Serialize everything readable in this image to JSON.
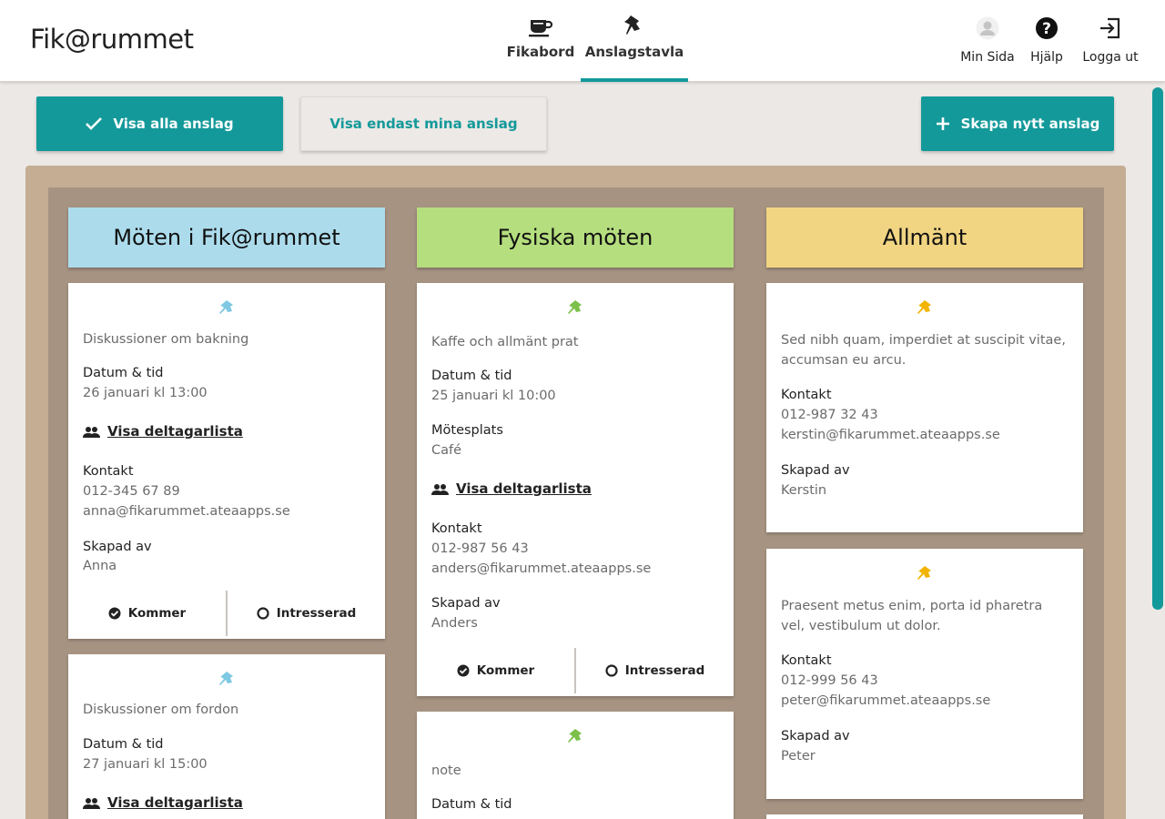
{
  "app": {
    "title": "Fik@rummet"
  },
  "nav": {
    "tabs": [
      {
        "label": "Fikabord",
        "icon": "coffee-cup-icon"
      },
      {
        "label": "Anslagstavla",
        "icon": "pushpin-icon",
        "active": true
      }
    ],
    "utility": [
      {
        "label": "Min Sida",
        "icon": "avatar-icon"
      },
      {
        "label": "Hjälp",
        "icon": "help-icon"
      },
      {
        "label": "Logga ut",
        "icon": "logout-icon"
      }
    ]
  },
  "toolbar": {
    "show_all": "Visa alla anslag",
    "show_mine": "Visa endast mina anslag",
    "create_new": "Skapa nytt anslag"
  },
  "colors": {
    "accent": "#14999a",
    "blue": "#acdcec",
    "green": "#b5de7e",
    "yellow": "#f1d582",
    "board": "#a69382"
  },
  "board": {
    "columns": [
      {
        "title": "Möten i Fik@rummet",
        "cards": [
          {
            "description": "Diskussioner om bakning",
            "datetime_label": "Datum & tid",
            "datetime": "26 januari kl 13:00",
            "participants_link": "Visa deltagarlista",
            "contact_label": "Kontakt",
            "phone": "012-345 67 89",
            "email": "anna@fikarummet.ateaapps.se",
            "created_label": "Skapad av",
            "created_by": "Anna",
            "attend": "Kommer",
            "interested": "Intresserad"
          },
          {
            "description": "Diskussioner om fordon",
            "datetime_label": "Datum & tid",
            "datetime": "27 januari kl 15:00",
            "participants_link": "Visa deltagarlista"
          }
        ]
      },
      {
        "title": "Fysiska möten",
        "cards": [
          {
            "description": "Kaffe och allmänt prat",
            "datetime_label": "Datum & tid",
            "datetime": "25 januari kl 10:00",
            "place_label": "Mötesplats",
            "place": "Café",
            "participants_link": "Visa deltagarlista",
            "contact_label": "Kontakt",
            "phone": "012-987 56 43",
            "email": "anders@fikarummet.ateaapps.se",
            "created_label": "Skapad av",
            "created_by": "Anders",
            "attend": "Kommer",
            "interested": "Intresserad"
          },
          {
            "description": "note",
            "datetime_label": "Datum & tid"
          }
        ]
      },
      {
        "title": "Allmänt",
        "cards": [
          {
            "description": "Sed nibh quam, imperdiet at suscipit vitae, accumsan eu arcu.",
            "contact_label": "Kontakt",
            "phone": "012-987 32 43",
            "email": "kerstin@fikarummet.ateaapps.se",
            "created_label": "Skapad av",
            "created_by": "Kerstin"
          },
          {
            "description": "Praesent metus enim, porta id pharetra vel, vestibulum ut dolor.",
            "contact_label": "Kontakt",
            "phone": "012-999 56 43",
            "email": "peter@fikarummet.ateaapps.se",
            "created_label": "Skapad av",
            "created_by": "Peter"
          }
        ]
      }
    ]
  }
}
